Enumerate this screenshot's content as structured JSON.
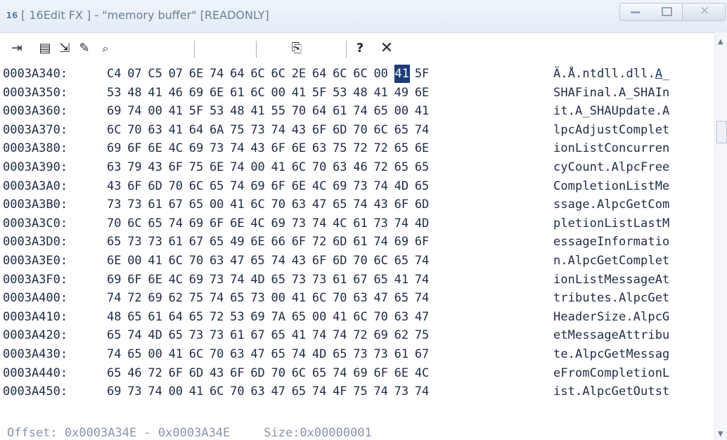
{
  "window": {
    "title": "[ 16Edit FX ] - \"memory buffer\" [READONLY]",
    "icon": "16edit-app-icon"
  },
  "toolbar": {
    "icons": [
      "pin-icon",
      "list-icon",
      "export-icon",
      "notepad-icon",
      "find-icon",
      "copy-icon",
      "help-icon",
      "close-icon"
    ]
  },
  "hex": {
    "rows": [
      {
        "addr": "0003A340:",
        "bytes": [
          "C4",
          "07",
          "C5",
          "07",
          "6E",
          "74",
          "64",
          "6C",
          "6C",
          "2E",
          "64",
          "6C",
          "6C",
          "00",
          "41",
          "5F"
        ],
        "ascii": "Ä.Å.ntdll.dll.A_"
      },
      {
        "addr": "0003A350:",
        "bytes": [
          "53",
          "48",
          "41",
          "46",
          "69",
          "6E",
          "61",
          "6C",
          "00",
          "41",
          "5F",
          "53",
          "48",
          "41",
          "49",
          "6E"
        ],
        "ascii": "SHAFinal.A_SHAIn"
      },
      {
        "addr": "0003A360:",
        "bytes": [
          "69",
          "74",
          "00",
          "41",
          "5F",
          "53",
          "48",
          "41",
          "55",
          "70",
          "64",
          "61",
          "74",
          "65",
          "00",
          "41"
        ],
        "ascii": "it.A_SHAUpdate.A"
      },
      {
        "addr": "0003A370:",
        "bytes": [
          "6C",
          "70",
          "63",
          "41",
          "64",
          "6A",
          "75",
          "73",
          "74",
          "43",
          "6F",
          "6D",
          "70",
          "6C",
          "65",
          "74"
        ],
        "ascii": "lpcAdjustComplet"
      },
      {
        "addr": "0003A380:",
        "bytes": [
          "69",
          "6F",
          "6E",
          "4C",
          "69",
          "73",
          "74",
          "43",
          "6F",
          "6E",
          "63",
          "75",
          "72",
          "72",
          "65",
          "6E"
        ],
        "ascii": "ionListConcurren"
      },
      {
        "addr": "0003A390:",
        "bytes": [
          "63",
          "79",
          "43",
          "6F",
          "75",
          "6E",
          "74",
          "00",
          "41",
          "6C",
          "70",
          "63",
          "46",
          "72",
          "65",
          "65"
        ],
        "ascii": "cyCount.AlpcFree"
      },
      {
        "addr": "0003A3A0:",
        "bytes": [
          "43",
          "6F",
          "6D",
          "70",
          "6C",
          "65",
          "74",
          "69",
          "6F",
          "6E",
          "4C",
          "69",
          "73",
          "74",
          "4D",
          "65"
        ],
        "ascii": "CompletionListMe"
      },
      {
        "addr": "0003A3B0:",
        "bytes": [
          "73",
          "73",
          "61",
          "67",
          "65",
          "00",
          "41",
          "6C",
          "70",
          "63",
          "47",
          "65",
          "74",
          "43",
          "6F",
          "6D"
        ],
        "ascii": "ssage.AlpcGetCom"
      },
      {
        "addr": "0003A3C0:",
        "bytes": [
          "70",
          "6C",
          "65",
          "74",
          "69",
          "6F",
          "6E",
          "4C",
          "69",
          "73",
          "74",
          "4C",
          "61",
          "73",
          "74",
          "4D"
        ],
        "ascii": "pletionListLastM"
      },
      {
        "addr": "0003A3D0:",
        "bytes": [
          "65",
          "73",
          "73",
          "61",
          "67",
          "65",
          "49",
          "6E",
          "66",
          "6F",
          "72",
          "6D",
          "61",
          "74",
          "69",
          "6F"
        ],
        "ascii": "essageInformatio"
      },
      {
        "addr": "0003A3E0:",
        "bytes": [
          "6E",
          "00",
          "41",
          "6C",
          "70",
          "63",
          "47",
          "65",
          "74",
          "43",
          "6F",
          "6D",
          "70",
          "6C",
          "65",
          "74"
        ],
        "ascii": "n.AlpcGetComplet"
      },
      {
        "addr": "0003A3F0:",
        "bytes": [
          "69",
          "6F",
          "6E",
          "4C",
          "69",
          "73",
          "74",
          "4D",
          "65",
          "73",
          "73",
          "61",
          "67",
          "65",
          "41",
          "74"
        ],
        "ascii": "ionListMessageAt"
      },
      {
        "addr": "0003A400:",
        "bytes": [
          "74",
          "72",
          "69",
          "62",
          "75",
          "74",
          "65",
          "73",
          "00",
          "41",
          "6C",
          "70",
          "63",
          "47",
          "65",
          "74"
        ],
        "ascii": "tributes.AlpcGet"
      },
      {
        "addr": "0003A410:",
        "bytes": [
          "48",
          "65",
          "61",
          "64",
          "65",
          "72",
          "53",
          "69",
          "7A",
          "65",
          "00",
          "41",
          "6C",
          "70",
          "63",
          "47"
        ],
        "ascii": "HeaderSize.AlpcG"
      },
      {
        "addr": "0003A420:",
        "bytes": [
          "65",
          "74",
          "4D",
          "65",
          "73",
          "73",
          "61",
          "67",
          "65",
          "41",
          "74",
          "74",
          "72",
          "69",
          "62",
          "75"
        ],
        "ascii": "etMessageAttribu"
      },
      {
        "addr": "0003A430:",
        "bytes": [
          "74",
          "65",
          "00",
          "41",
          "6C",
          "70",
          "63",
          "47",
          "65",
          "74",
          "4D",
          "65",
          "73",
          "73",
          "61",
          "67"
        ],
        "ascii": "te.AlpcGetMessag"
      },
      {
        "addr": "0003A440:",
        "bytes": [
          "65",
          "46",
          "72",
          "6F",
          "6D",
          "43",
          "6F",
          "6D",
          "70",
          "6C",
          "65",
          "74",
          "69",
          "6F",
          "6E",
          "4C"
        ],
        "ascii": "eFromCompletionL"
      },
      {
        "addr": "0003A450:",
        "bytes": [
          "69",
          "73",
          "74",
          "00",
          "41",
          "6C",
          "70",
          "63",
          "47",
          "65",
          "74",
          "4F",
          "75",
          "74",
          "73",
          "74"
        ],
        "ascii": "ist.AlpcGetOutst"
      }
    ],
    "selected_row": 0,
    "selected_byte": 14
  },
  "status": {
    "offset": "Offset: 0x0003A34E - 0x0003A34E",
    "size": "Size:0x00000001"
  }
}
